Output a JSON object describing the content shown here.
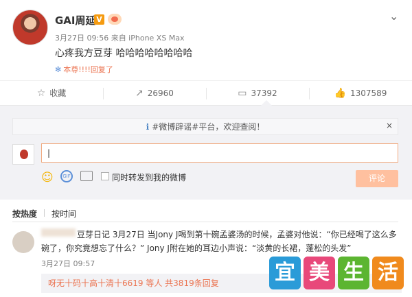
{
  "post": {
    "author": "GAI周延",
    "v_badge": "V",
    "meta": "3月27日 09:56 来自 iPhone XS Max",
    "text": "心疼我方豆芽 哈哈哈哈哈哈哈哈",
    "reply_tag_icon": "✻",
    "reply_tag": "本尊!!!!回复了"
  },
  "actions": [
    {
      "icon": "star-icon",
      "glyph": "☆",
      "label": "收藏"
    },
    {
      "icon": "share-icon",
      "glyph": "↗",
      "label": "26960"
    },
    {
      "icon": "comment-icon",
      "glyph": "▭",
      "label": "37392"
    },
    {
      "icon": "like-icon",
      "glyph": "👍",
      "label": "1307589"
    }
  ],
  "comment_box": {
    "notice": "#微博辟谣#平台，欢迎查阅！",
    "notice_icon": "ℹ",
    "close_glyph": "×",
    "input_value": "|",
    "repost_label": "同时转发到我的微博",
    "submit_label": "评论"
  },
  "tabs": {
    "hot": "按热度",
    "time": "按时间"
  },
  "top_comment": {
    "text": "豆芽日记 3月27日 当Jony J喝到第十碗孟婆汤的时候，孟婆对他说：“你已经喝了这么多碗了，你究竟想忘了什么？” Jony J附在她的耳边小声说：“淡黄的长裙，蓬松的头发”",
    "time": "3月27日 09:57",
    "replies": "呀无十码十高十清十6619 等人 共3819条回复"
  },
  "watermark": {
    "chars": [
      "宜",
      "美",
      "生",
      "活"
    ],
    "colors": [
      "#2a9bd8",
      "#e8487a",
      "#5cb531",
      "#f08a1d"
    ]
  },
  "colors": {
    "accent": "#eb7350",
    "submit_disabled": "#ffc09f",
    "comment_bg": "#f2f2f5"
  }
}
